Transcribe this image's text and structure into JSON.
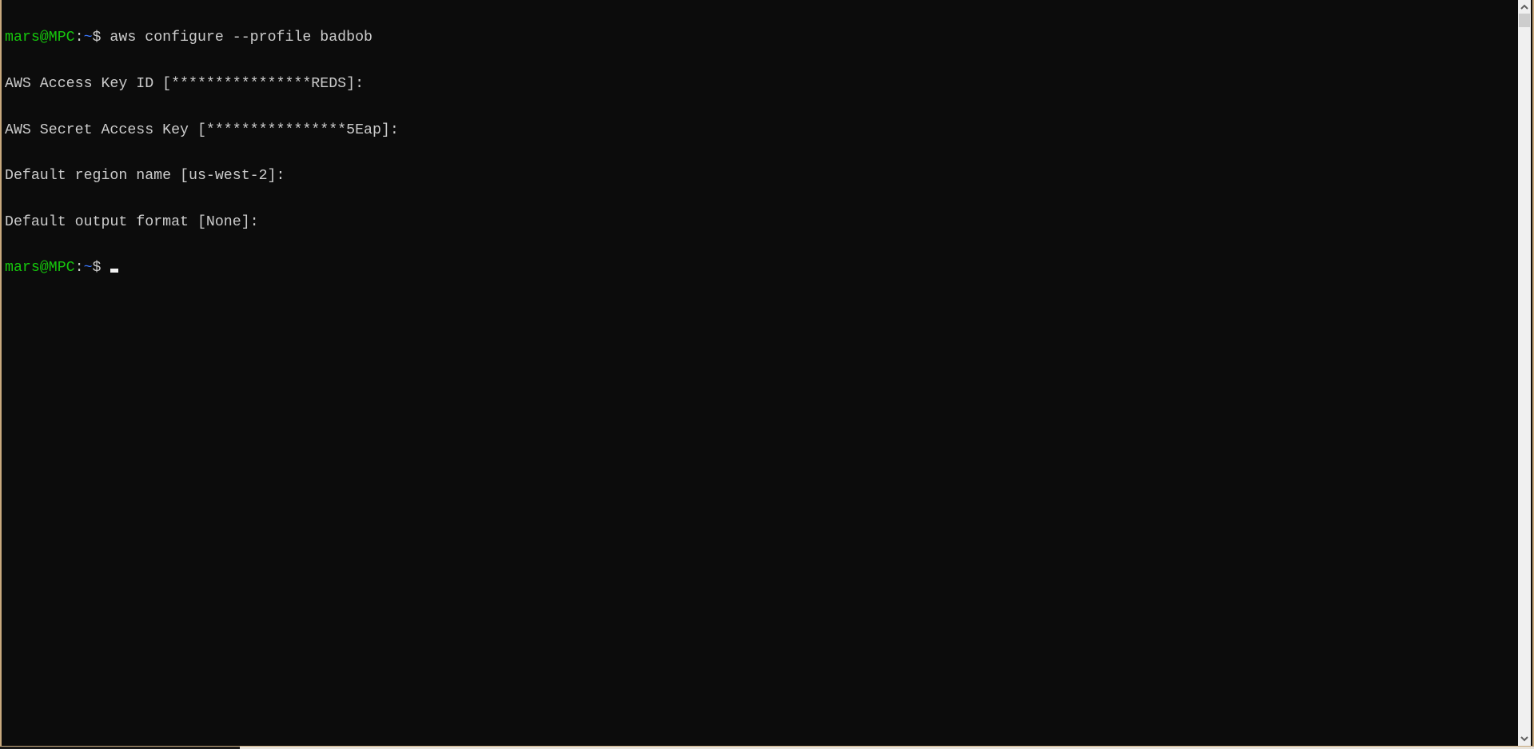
{
  "terminal": {
    "prompt": {
      "user_host": "mars@MPC",
      "colon": ":",
      "path": "~",
      "symbol": "$"
    },
    "lines": [
      {
        "type": "command",
        "command": " aws configure --profile badbob"
      },
      {
        "type": "output",
        "text": "AWS Access Key ID [****************REDS]:"
      },
      {
        "type": "output",
        "text": "AWS Secret Access Key [****************5Eap]:"
      },
      {
        "type": "output",
        "text": "Default region name [us-west-2]:"
      },
      {
        "type": "output",
        "text": "Default output format [None]:"
      },
      {
        "type": "prompt",
        "command": " "
      }
    ]
  },
  "scrollbar": {
    "up_icon": "chevron-up-icon",
    "down_icon": "chevron-down-icon",
    "up_glyph": "⌃",
    "down_glyph": "⌄"
  },
  "colors": {
    "background": "#0c0c0c",
    "text": "#cccccc",
    "user_host": "#16c60c",
    "path": "#3b78ff",
    "border": "#c8a97e"
  }
}
